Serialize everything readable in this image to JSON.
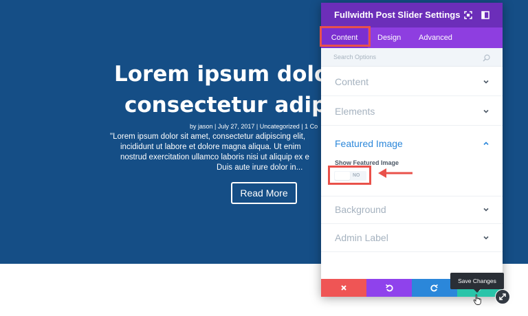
{
  "hero": {
    "title_line1": "Lorem ipsum dolor",
    "title_line2": "consectetur adipis",
    "meta": "by jason | July 27, 2017 | Uncategorized | 1 Co",
    "excerpt_line1": "\"Lorem ipsum dolor sit amet, consectetur adipiscing elit,",
    "excerpt_line2": "incididunt ut labore et dolore magna aliqua. Ut enim",
    "excerpt_line3": "nostrud exercitation ullamco laboris nisi ut aliquip ex e",
    "excerpt_line4": "Duis aute irure dolor in...",
    "button_label": "Read More",
    "bg_color": "#154e86"
  },
  "modal": {
    "title": "Fullwidth Post Slider Settings",
    "header_icons": [
      "fullscreen-icon",
      "sidebar-icon"
    ],
    "tabs": [
      {
        "label": "Content",
        "active": true
      },
      {
        "label": "Design",
        "active": false
      },
      {
        "label": "Advanced",
        "active": false
      }
    ],
    "search": {
      "placeholder": "Search Options"
    },
    "sections": [
      {
        "label": "Content",
        "open": false
      },
      {
        "label": "Elements",
        "open": false
      },
      {
        "label": "Featured Image",
        "open": true
      },
      {
        "label": "Background",
        "open": false
      },
      {
        "label": "Admin Label",
        "open": false
      }
    ],
    "featured_image": {
      "toggle_label": "Show Featured Image",
      "toggle_value": "NO"
    },
    "footer": {
      "buttons": [
        {
          "name": "discard",
          "icon": "close-icon",
          "color": "#ef5555"
        },
        {
          "name": "undo",
          "icon": "undo-icon",
          "color": "#8f42ec"
        },
        {
          "name": "redo",
          "icon": "redo-icon",
          "color": "#2b87da"
        },
        {
          "name": "save",
          "icon": "check-icon",
          "color": "#29c4a9"
        }
      ]
    },
    "colors": {
      "header": "#6c2eb9",
      "tabs": "#8e3ee0",
      "accent": "#2b87da",
      "highlight": "#e9514a"
    }
  },
  "tooltip": {
    "text": "Save Changes"
  }
}
